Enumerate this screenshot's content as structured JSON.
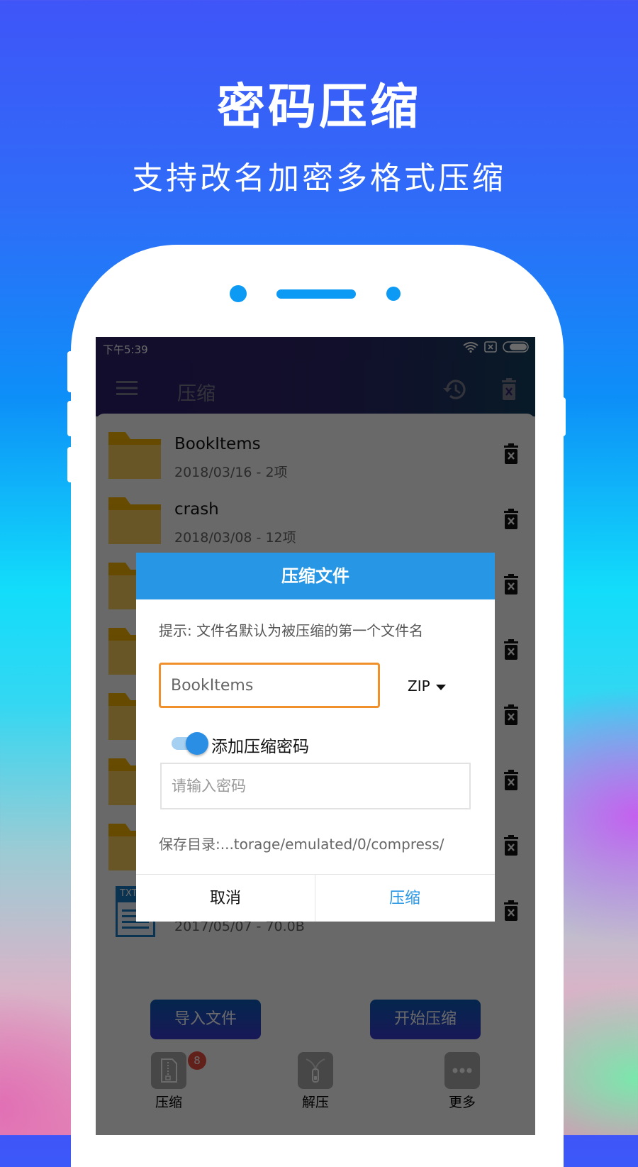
{
  "hero": {
    "title": "密码压缩",
    "subtitle": "支持改名加密多格式压缩"
  },
  "statusbar": {
    "time": "下午5:39",
    "icons": [
      "wifi-icon",
      "sim-no-signal-icon",
      "battery-icon"
    ]
  },
  "toolbar": {
    "title": "压缩",
    "menu_icon": "menu-icon",
    "history_icon": "history-icon",
    "clear_icon": "trash-icon"
  },
  "files": [
    {
      "name": "BookItems",
      "meta": "2018/03/16 - 2项",
      "type": "folder"
    },
    {
      "name": "crash",
      "meta": "2018/03/08 - 12项",
      "type": "folder"
    },
    {
      "name": "",
      "meta": "",
      "type": "folder"
    },
    {
      "name": "",
      "meta": "",
      "type": "folder"
    },
    {
      "name": "",
      "meta": "",
      "type": "folder"
    },
    {
      "name": "",
      "meta": "",
      "type": "folder"
    },
    {
      "name": "",
      "meta": "",
      "type": "folder"
    },
    {
      "name": "",
      "meta": "2017/05/07 - 70.0B",
      "type": "txt",
      "icon_label": "TXT"
    }
  ],
  "actions": {
    "import_label": "导入文件",
    "start_label": "开始压缩"
  },
  "bottom_nav": [
    {
      "label": "压缩",
      "icon": "compress-file-icon",
      "badge": "8"
    },
    {
      "label": "解压",
      "icon": "zipper-icon"
    },
    {
      "label": "更多",
      "icon": "more-icon"
    }
  ],
  "dialog": {
    "title": "压缩文件",
    "hint": "提示: 文件名默认为被压缩的第一个文件名",
    "filename_value": "BookItems",
    "format_selected": "ZIP",
    "password_toggle_label": "添加压缩密码",
    "password_toggle_on": true,
    "password_placeholder": "请输入密码",
    "save_path": "保存目录:...torage/emulated/0/compress/",
    "cancel_label": "取消",
    "confirm_label": "压缩"
  },
  "colors": {
    "dialog_header": "#2796e4",
    "confirm_text": "#2796e4",
    "input_focus_border": "#f0902a",
    "badge": "#e74c3c",
    "folder": "#f7cd5c"
  }
}
